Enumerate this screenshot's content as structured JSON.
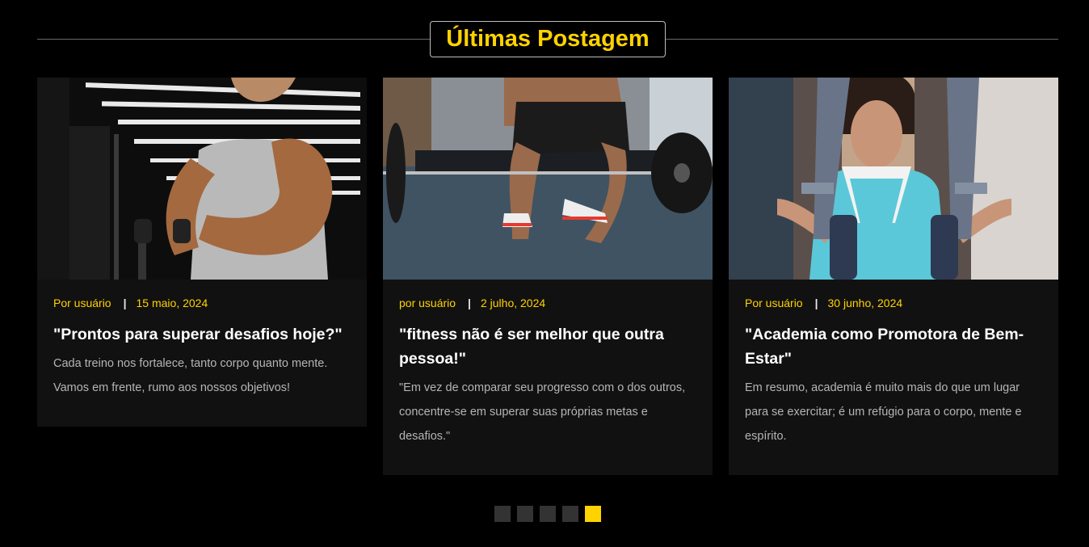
{
  "section": {
    "title": "Últimas Postagem"
  },
  "colors": {
    "accent": "#ffd200",
    "background": "#000000",
    "card": "#111111"
  },
  "posts": [
    {
      "image": "bodybuilder-cable-curl-photo",
      "author": "Por usuário",
      "date": "15 maio, 2024",
      "title": "\"Prontos para superar desafios hoje?\"",
      "excerpt": "Cada treino nos fortalece, tanto corpo quanto mente. Vamos em frente, rumo aos nossos objetivos!"
    },
    {
      "image": "deadlift-barbell-photo",
      "author": "por usuário",
      "date": "2 julho, 2024",
      "title": "\"fitness não é ser melhor que outra pessoa!\"",
      "excerpt": "\"Em vez de comparar seu progresso com o dos outros, concentre-se em superar suas próprias metas e desafios.\""
    },
    {
      "image": "woman-chest-press-machine-photo",
      "author": "Por usuário",
      "date": "30 junho, 2024",
      "title": "\"Academia como Promotora de Bem-Estar\"",
      "excerpt": "Em resumo, academia é muito mais do que um lugar para se exercitar; é um refúgio para o corpo, mente e espírito."
    }
  ],
  "pagination": {
    "pages": 5,
    "active": 5
  }
}
